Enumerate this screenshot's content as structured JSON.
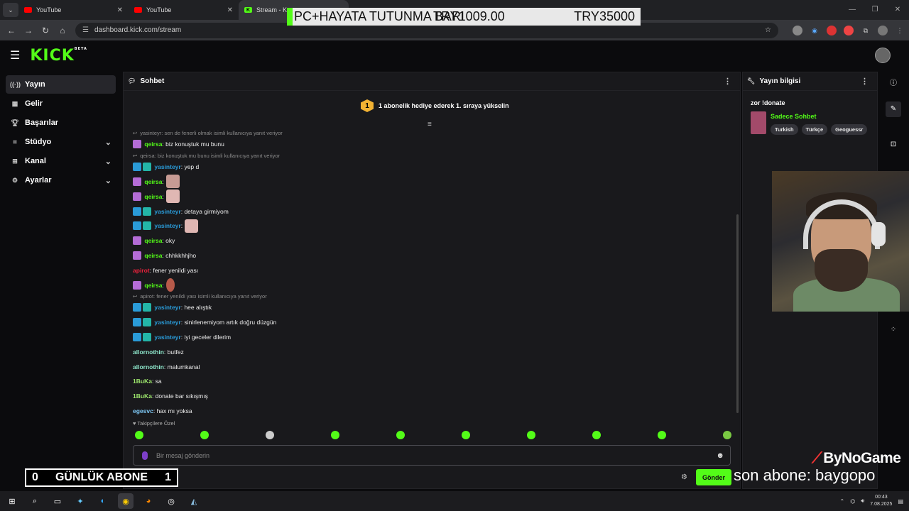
{
  "browser": {
    "tabs": [
      {
        "label": "YouTube",
        "icon": "youtube-icon"
      },
      {
        "label": "YouTube",
        "icon": "youtube-icon"
      },
      {
        "label": "Stream - K",
        "icon": "kick-icon"
      }
    ],
    "url": "dashboard.kick.com/stream"
  },
  "overlay_top": {
    "left_text": "PC+HAYATA TUTUNMA BARI",
    "overlap_text": "TRY1009.00",
    "right_text": "TRY35000"
  },
  "kick": {
    "logo": "KICK",
    "logo_sup": "BETA"
  },
  "sidebar": {
    "items": [
      {
        "label": "Yayın",
        "icon": "broadcast-icon"
      },
      {
        "label": "Gelir",
        "icon": "revenue-icon"
      },
      {
        "label": "Başarılar",
        "icon": "trophy-icon"
      },
      {
        "label": "Stüdyo",
        "icon": "studio-icon"
      },
      {
        "label": "Kanal",
        "icon": "channel-icon"
      },
      {
        "label": "Ayarlar",
        "icon": "gear-icon"
      }
    ]
  },
  "chat": {
    "title": "Sohbet",
    "gift_badge": "1",
    "gift_text": "1 abonelik hediye ederek 1. sıraya yükselin",
    "messages": [
      {
        "type": "reply",
        "text": "yasinteyr: sen de fenerli olmak isimli kullanıcıya yanıt veriyor"
      },
      {
        "user": "qeirsa",
        "text": ": biz konuştuk mu bunu",
        "color": "#53fc18",
        "badges": [
          "purple"
        ]
      },
      {
        "type": "reply",
        "text": "qeirsa: biz konuştuk mu bunu isimli kullanıcıya yanıt veriyor"
      },
      {
        "user": "yasinteyr",
        "text": ": yep d",
        "color": "#2a9bd8",
        "badges": [
          "blue",
          "teal"
        ]
      },
      {
        "user": "qeirsa",
        "text": ":",
        "color": "#53fc18",
        "badges": [
          "purple"
        ],
        "emote": "e1"
      },
      {
        "user": "qeirsa",
        "text": ":",
        "color": "#53fc18",
        "badges": [
          "purple"
        ],
        "emote": "e2"
      },
      {
        "user": "yasinteyr",
        "text": ": detaya girmiyom",
        "color": "#2a9bd8",
        "badges": [
          "blue",
          "teal"
        ]
      },
      {
        "user": "yasinteyr",
        "text": ":",
        "color": "#2a9bd8",
        "badges": [
          "blue",
          "teal"
        ],
        "emote": "e2"
      },
      {
        "user": "qeirsa",
        "text": ": oky",
        "color": "#53fc18",
        "badges": [
          "purple"
        ]
      },
      {
        "user": "qeirsa",
        "text": ": chhkkhhjho",
        "color": "#53fc18",
        "badges": [
          "purple"
        ]
      },
      {
        "user": "apirot",
        "text": ": fener yenildi yası",
        "color": "#e8213b",
        "badges": []
      },
      {
        "user": "qeirsa",
        "text": ":",
        "color": "#53fc18",
        "badges": [
          "purple"
        ],
        "emote": "e3"
      },
      {
        "type": "reply",
        "text": "apirot: fener yenildi yası isimli kullanıcıya yanıt veriyor"
      },
      {
        "user": "yasinteyr",
        "text": ": hee alıştık",
        "color": "#2a9bd8",
        "badges": [
          "blue",
          "teal"
        ]
      },
      {
        "user": "yasinteyr",
        "text": ": sinirlenemiyom artık doğru düzgün",
        "color": "#2a9bd8",
        "badges": [
          "blue",
          "teal"
        ]
      },
      {
        "user": "yasinteyr",
        "text": ": iyi geceler dilerim",
        "color": "#2a9bd8",
        "badges": [
          "blue",
          "teal"
        ]
      },
      {
        "user": "allornothin",
        "text": ": butfez",
        "color": "#8ce3c8",
        "badges": []
      },
      {
        "user": "allornothin",
        "text": ": malumkanal",
        "color": "#8ce3c8",
        "badges": []
      },
      {
        "user": "1BuKa",
        "text": ": sa",
        "color": "#9be36b",
        "badges": []
      },
      {
        "user": "1BuKa",
        "text": ": donate bar sıkışmış",
        "color": "#9be36b",
        "badges": []
      },
      {
        "user": "egesvc",
        "text": ": hax mı yoksa",
        "color": "#7ec8f5",
        "badges": []
      }
    ],
    "emote_label": "Takipçilere Özel",
    "input_placeholder": "Bir mesaj gönderin",
    "send_label": "Gönder"
  },
  "info": {
    "title": "Yayın bilgisi",
    "stream_title": "zor !donate",
    "category": "Sadece Sohbet",
    "tags": [
      "Turkish",
      "Türkçe",
      "Geoguessr"
    ]
  },
  "overlays": {
    "sub_left": "0",
    "sub_label": "GÜNLÜK ABONE",
    "sub_right": "1",
    "sponsor": "ByNoGame",
    "last_sub": "son abone: baygopo"
  },
  "taskbar": {
    "time": "00:43",
    "date": "7.08.2025"
  }
}
